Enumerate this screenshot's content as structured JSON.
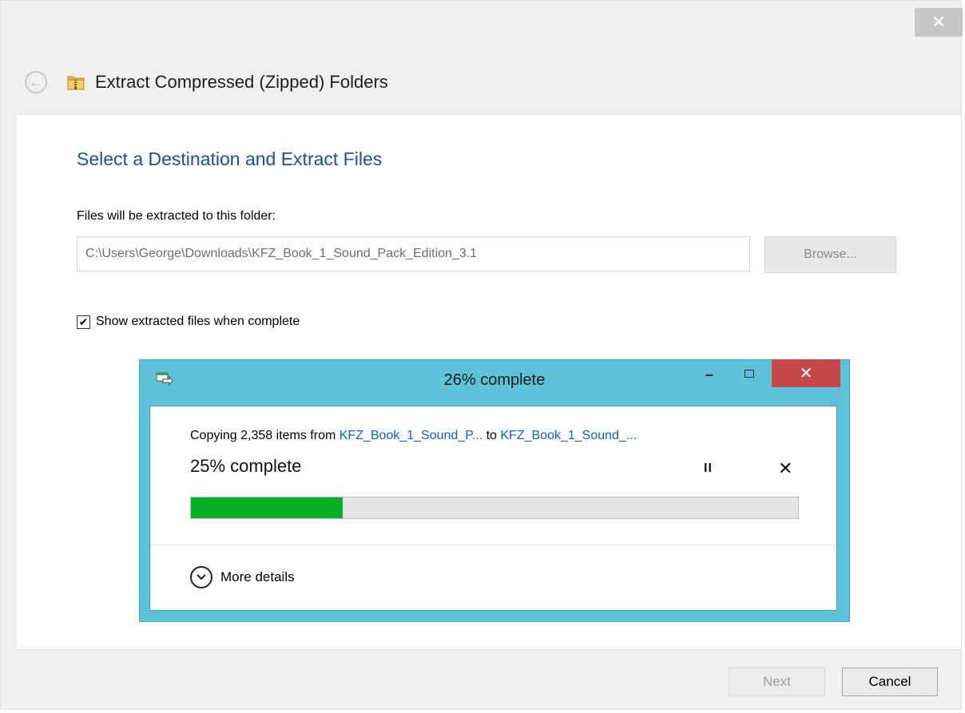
{
  "window": {
    "close_glyph": "✕",
    "title": "Extract Compressed (Zipped) Folders",
    "back_glyph": "←"
  },
  "content": {
    "heading": "Select a Destination and Extract Files",
    "destination_label": "Files will be extracted to this folder:",
    "destination_path": "C:\\Users\\George\\Downloads\\KFZ_Book_1_Sound_Pack_Edition_3.1",
    "browse_label": "Browse...",
    "show_files_checked": true,
    "show_files_label": "Show extracted files when complete",
    "checkbox_glyph": "✔"
  },
  "progress_dialog": {
    "title": "26% complete",
    "minimize_glyph": "–",
    "close_glyph": "✕",
    "copy_prefix": "Copying 2,358 items from ",
    "source_link": "KFZ_Book_1_Sound_P...",
    "copy_middle": " to ",
    "dest_link": "KFZ_Book_1_Sound_...",
    "percent_text": "25% complete",
    "progress_fraction": 0.25,
    "pause_glyph": "II",
    "cancel_glyph": "✕",
    "more_details_label": "More details",
    "colors": {
      "frame": "#5cc3d8",
      "close": "#c74848",
      "progress": "#06b025",
      "link": "#0b63c9"
    }
  },
  "footer": {
    "next_label": "Next",
    "cancel_label": "Cancel"
  },
  "icons": [
    "back-arrow-icon",
    "zip-folder-icon",
    "copy-icon",
    "chevron-down-icon",
    "pause-icon",
    "close-icon"
  ]
}
